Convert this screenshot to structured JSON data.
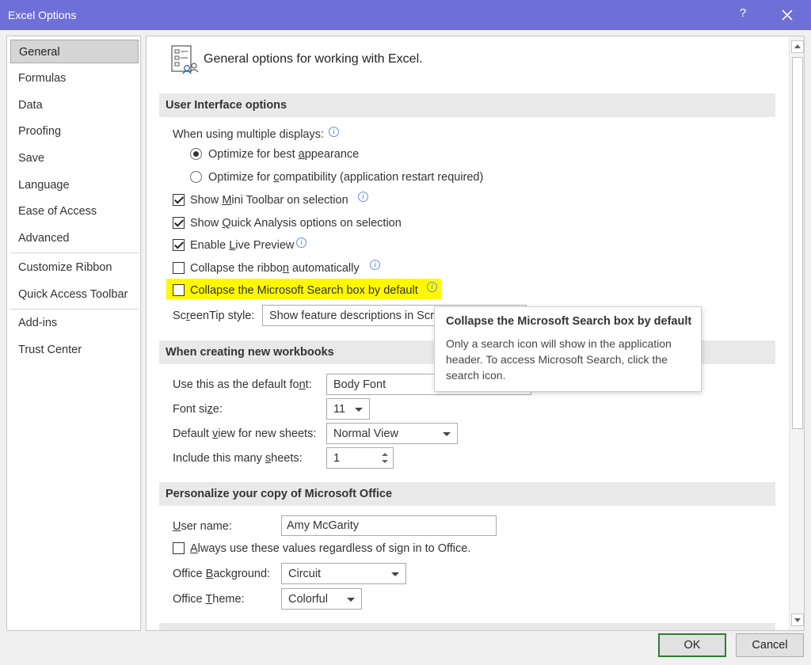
{
  "window": {
    "title": "Excel Options",
    "help_label": "?",
    "accent_color": "#6f6fd8"
  },
  "sidebar": {
    "items": [
      {
        "label": "General",
        "selected": true
      },
      {
        "label": "Formulas"
      },
      {
        "label": "Data"
      },
      {
        "label": "Proofing"
      },
      {
        "label": "Save"
      },
      {
        "label": "Language"
      },
      {
        "label": "Ease of Access"
      },
      {
        "label": "Advanced"
      },
      {
        "label": "Customize Ribbon"
      },
      {
        "label": "Quick Access Toolbar"
      },
      {
        "label": "Add-ins"
      },
      {
        "label": "Trust Center"
      }
    ]
  },
  "content": {
    "heading": "General options for working with Excel.",
    "heading_icon": "general-options-icon",
    "ui_options": {
      "header": "User Interface options",
      "multi_display_label": "When using multiple displays:",
      "radio_appearance": {
        "before": "Optimize for best ",
        "accel": "a",
        "after": "ppearance",
        "selected": true
      },
      "radio_compat": {
        "before": "Optimize for ",
        "accel": "c",
        "after": "ompatibility (application restart required)",
        "selected": false
      },
      "mini_toolbar": {
        "before": "Show ",
        "accel": "M",
        "after": "ini Toolbar on selection",
        "checked": true
      },
      "quick_analysis": {
        "before": "Show ",
        "accel": "Q",
        "after": "uick Analysis options on selection",
        "checked": true
      },
      "live_preview": {
        "before": "Enable ",
        "accel": "L",
        "after": "ive Preview",
        "checked": true
      },
      "collapse_ribbon": {
        "before": "Collapse the ribbo",
        "accel": "n",
        "after": " automatically",
        "checked": false
      },
      "collapse_search": {
        "label": "Collapse the Microsoft Search box by default",
        "checked": false,
        "highlight_color": "#fff800"
      },
      "screentip": {
        "before": "Sc",
        "accel": "r",
        "after": "eenTip style:",
        "value": "Show feature descriptions in ScreenTips"
      }
    },
    "new_workbooks": {
      "header": "When creating new workbooks",
      "default_font": {
        "before": "Use this as the default fo",
        "accel": "n",
        "after": "t:",
        "value": "Body Font"
      },
      "font_size": {
        "before": "Font si",
        "accel": "z",
        "after": "e:",
        "value": "11"
      },
      "default_view": {
        "before": "Default ",
        "accel": "v",
        "after": "iew for new sheets:",
        "value": "Normal View"
      },
      "sheets": {
        "before": "Include this many ",
        "accel": "s",
        "after": "heets:",
        "value": "1"
      }
    },
    "personalize": {
      "header": "Personalize your copy of Microsoft Office",
      "user_name": {
        "before": "",
        "accel": "U",
        "after": "ser name:",
        "value": "Amy McGarity"
      },
      "always_use": {
        "before": "",
        "accel": "A",
        "after": "lways use these values regardless of sign in to Office.",
        "checked": false
      },
      "background": {
        "before": "Office ",
        "accel": "B",
        "after": "ackground:",
        "value": "Circuit"
      },
      "theme": {
        "before": "Office ",
        "accel": "T",
        "after": "heme:",
        "value": "Colorful"
      }
    }
  },
  "tooltip": {
    "title": "Collapse the Microsoft Search box by default",
    "body": "Only a search icon will show in the application header. To access Microsoft Search, click the search icon."
  },
  "buttons": {
    "ok": "OK",
    "cancel": "Cancel",
    "ok_border_color": "#2e7d32"
  }
}
